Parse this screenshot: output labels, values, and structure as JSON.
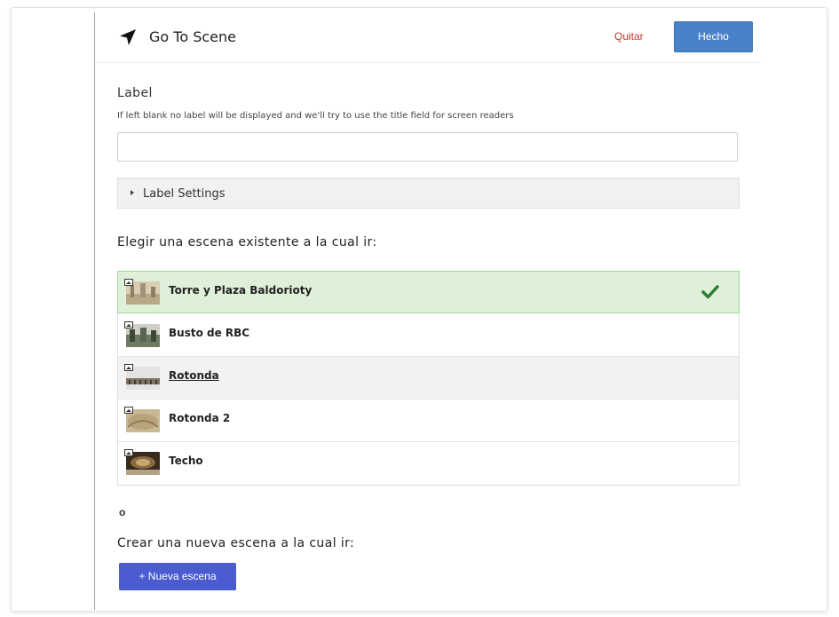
{
  "header": {
    "title": "Go To Scene",
    "icon": "navigate-arrow-icon",
    "quit_label": "Quitar",
    "done_label": "Hecho"
  },
  "label_field": {
    "title": "Label",
    "help_text": "If left blank no label will be displayed and we'll try to use the title field for screen readers",
    "value": "",
    "placeholder": ""
  },
  "label_settings": {
    "label": "Label Settings",
    "expanded": false
  },
  "existing_scene": {
    "heading": "Elegir una escena existente a la cual ir:",
    "scenes": [
      {
        "name": "Torre y Plaza Baldorioty",
        "selected": true,
        "hovered": false
      },
      {
        "name": "Busto de RBC",
        "selected": false,
        "hovered": false
      },
      {
        "name": "Rotonda",
        "selected": false,
        "hovered": true
      },
      {
        "name": "Rotonda 2",
        "selected": false,
        "hovered": false
      },
      {
        "name": "Techo",
        "selected": false,
        "hovered": false
      }
    ]
  },
  "or_text": "o",
  "new_scene": {
    "heading": "Crear una nueva escena a la cual ir:",
    "button_label": "+ Nueva escena"
  },
  "colors": {
    "quit": "#c0392b",
    "done_button": "#4a82c9",
    "selected_row": "#dff0d8",
    "check": "#2e7d32",
    "new_scene_button": "#4a5ccf"
  }
}
